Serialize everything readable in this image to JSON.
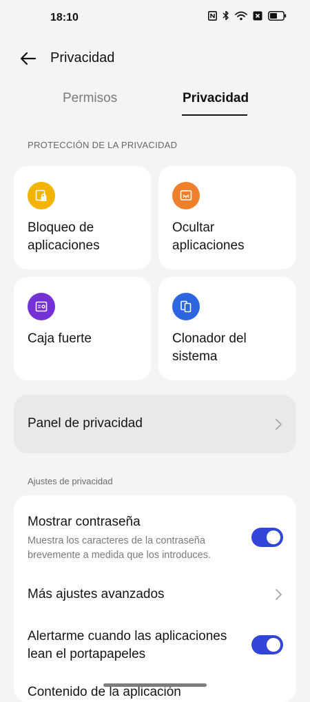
{
  "status_bar": {
    "time": "18:10",
    "icons": [
      "nfc-icon",
      "bluetooth-icon",
      "wifi-icon",
      "sim-off-icon",
      "battery-icon"
    ]
  },
  "appbar": {
    "back_icon": "arrow-left-icon",
    "title": "Privacidad"
  },
  "tabs": [
    {
      "label": "Permisos",
      "selected": false
    },
    {
      "label": "Privacidad",
      "selected": true
    }
  ],
  "section_protection": {
    "header": "PROTECCIÓN DE LA PRIVACIDAD",
    "cards": [
      {
        "label": "Bloqueo de aplicaciones",
        "icon": "app-lock-icon",
        "color": "#f5b400"
      },
      {
        "label": "Ocultar aplicaciones",
        "icon": "hide-apps-icon",
        "color": "#f07f2b"
      },
      {
        "label": "Caja fuerte",
        "icon": "safe-icon",
        "color": "#7431d6"
      },
      {
        "label": "Clonador del sistema",
        "icon": "clone-icon",
        "color": "#2b66e0"
      }
    ]
  },
  "panel": {
    "label": "Panel de privacidad",
    "icon": "chevron-right-icon"
  },
  "section_settings": {
    "header": "Ajustes de privacidad",
    "items": [
      {
        "title": "Mostrar contraseña",
        "subtitle": "Muestra los caracteres de la contraseña brevemente a medida que los introduces.",
        "control": "toggle",
        "on": true
      },
      {
        "title": "Más ajustes avanzados",
        "control": "chevron"
      },
      {
        "title": "Alertarme cuando las aplicaciones lean el portapapeles",
        "control": "toggle",
        "on": true
      },
      {
        "title": "Contenido de la aplicación",
        "control": "none"
      }
    ]
  },
  "colors": {
    "accent": "#3146d8",
    "background": "#f4f4f4"
  }
}
